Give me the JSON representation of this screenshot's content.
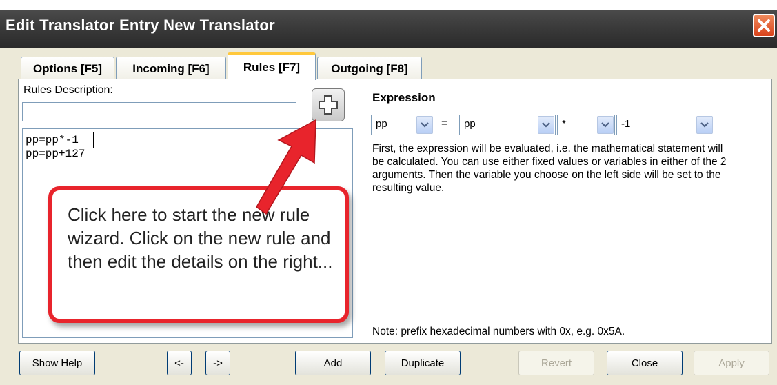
{
  "window": {
    "title": "Edit Translator Entry New Translator",
    "close_label": "×"
  },
  "tabs": [
    {
      "label": "Options [F5]",
      "active": false
    },
    {
      "label": "Incoming [F6]",
      "active": false
    },
    {
      "label": "Rules [F7]",
      "active": true
    },
    {
      "label": "Outgoing [F8]",
      "active": false
    }
  ],
  "rules": {
    "description_label": "Rules Description:",
    "description_value": "",
    "lines": [
      "pp=pp*-1",
      "pp=pp+127"
    ]
  },
  "expression": {
    "heading": "Expression",
    "target": "pp",
    "equals": "=",
    "operand1": "pp",
    "operator": "*",
    "operand2": "-1",
    "help_text": "First, the expression will be evaluated, i.e. the mathematical statement will be calculated. You can use either fixed values or variables in either of the 2 arguments. Then the variable you choose on the left side will be set to the resulting value.",
    "note": "Note: prefix hexadecimal numbers with 0x, e.g. 0x5A."
  },
  "callout": {
    "text": "Click here to start the new rule wizard.  Click on the new rule and then edit the details on the right..."
  },
  "buttons": {
    "show_help": "Show Help",
    "prev": "<-",
    "next": "->",
    "add": "Add",
    "duplicate": "Duplicate",
    "revert": "Revert",
    "close": "Close",
    "apply": "Apply"
  },
  "colors": {
    "callout_border": "#e8242c",
    "title_bar": "#3a3a3a",
    "active_tab_accent": "#ffc83c"
  },
  "icons": {
    "add_rule": "plus-icon",
    "dropdown": "chevron-down-icon",
    "close": "close-icon",
    "arrow": "red-arrow-icon"
  }
}
